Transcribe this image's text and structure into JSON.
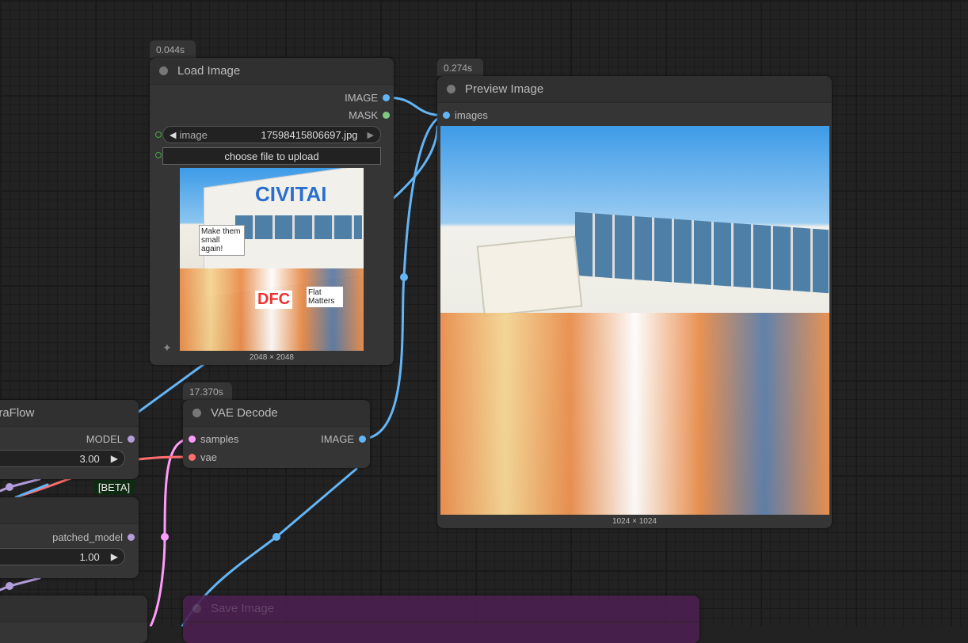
{
  "colors": {
    "image": "#64b5f6",
    "mask": "#81c784",
    "model": "#b39ddb",
    "vae": "#ff6e6e",
    "latent": "#ff9cf9",
    "canvas": "#222222",
    "save_node": "#4a1f4f"
  },
  "load_image": {
    "timing": "0.044s",
    "title": "Load Image",
    "outputs": [
      "IMAGE",
      "MASK"
    ],
    "image_label": "image",
    "image_value": "17598415806697.jpg",
    "upload_label": "choose file to upload",
    "dimensions": "2048 × 2048",
    "image_text": {
      "logo": "CIVITAI",
      "sign1": "Make them small again!",
      "sign2": "DFC",
      "sign3": "Flat Matters"
    }
  },
  "preview_image": {
    "timing": "0.274s",
    "title": "Preview Image",
    "input": "images",
    "dimensions": "1024 × 1024"
  },
  "vae_decode": {
    "timing": "17.370s",
    "title": "VAE Decode",
    "inputs": [
      "samples",
      "vae"
    ],
    "output": "IMAGE"
  },
  "auraflow_node": {
    "title": "uraFlow",
    "output": "MODEL",
    "value": "3.00",
    "badge": "[BETA]"
  },
  "patch_node": {
    "output": "patched_model",
    "value": "1.00"
  },
  "save_image": {
    "title": "Save Image"
  }
}
